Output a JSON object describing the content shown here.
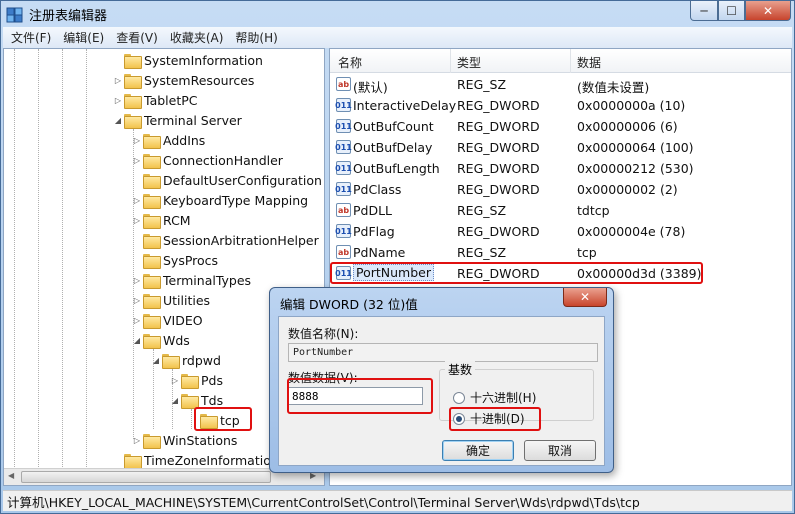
{
  "window": {
    "title": "注册表编辑器",
    "min_label": "─",
    "max_label": "☐",
    "close_label": "✕"
  },
  "menu": [
    "文件(F)",
    "编辑(E)",
    "查看(V)",
    "收藏夹(A)",
    "帮助(H)"
  ],
  "tree": {
    "items": [
      {
        "label": "SystemInformation",
        "arrow": ""
      },
      {
        "label": "SystemResources",
        "arrow": "▷"
      },
      {
        "label": "TabletPC",
        "arrow": "▷"
      },
      {
        "label": "Terminal Server",
        "arrow": "◢"
      },
      {
        "label": "AddIns",
        "arrow": "▷"
      },
      {
        "label": "ConnectionHandler",
        "arrow": "▷"
      },
      {
        "label": "DefaultUserConfiguration",
        "arrow": ""
      },
      {
        "label": "KeyboardType Mapping",
        "arrow": "▷"
      },
      {
        "label": "RCM",
        "arrow": "▷"
      },
      {
        "label": "SessionArbitrationHelper",
        "arrow": ""
      },
      {
        "label": "SysProcs",
        "arrow": ""
      },
      {
        "label": "TerminalTypes",
        "arrow": "▷"
      },
      {
        "label": "Utilities",
        "arrow": "▷"
      },
      {
        "label": "VIDEO",
        "arrow": "▷"
      },
      {
        "label": "Wds",
        "arrow": "◢"
      },
      {
        "label": "rdpwd",
        "arrow": "◢"
      },
      {
        "label": "Pds",
        "arrow": "▷"
      },
      {
        "label": "Tds",
        "arrow": "◢"
      },
      {
        "label": "tcp",
        "arrow": ""
      },
      {
        "label": "WinStations",
        "arrow": "▷"
      },
      {
        "label": "TimeZoneInformation",
        "arrow": ""
      }
    ]
  },
  "list": {
    "headers": [
      "名称",
      "类型",
      "数据"
    ],
    "rows": [
      {
        "icon": "ab",
        "name": "(默认)",
        "type": "REG_SZ",
        "data": "(数值未设置)"
      },
      {
        "icon": "011",
        "name": "InteractiveDelay",
        "type": "REG_DWORD",
        "data": "0x0000000a (10)"
      },
      {
        "icon": "011",
        "name": "OutBufCount",
        "type": "REG_DWORD",
        "data": "0x00000006 (6)"
      },
      {
        "icon": "011",
        "name": "OutBufDelay",
        "type": "REG_DWORD",
        "data": "0x00000064 (100)"
      },
      {
        "icon": "011",
        "name": "OutBufLength",
        "type": "REG_DWORD",
        "data": "0x00000212 (530)"
      },
      {
        "icon": "011",
        "name": "PdClass",
        "type": "REG_DWORD",
        "data": "0x00000002 (2)"
      },
      {
        "icon": "ab",
        "name": "PdDLL",
        "type": "REG_SZ",
        "data": "tdtcp"
      },
      {
        "icon": "011",
        "name": "PdFlag",
        "type": "REG_DWORD",
        "data": "0x0000004e (78)"
      },
      {
        "icon": "ab",
        "name": "PdName",
        "type": "REG_SZ",
        "data": "tcp"
      },
      {
        "icon": "011",
        "name": "PortNumber",
        "type": "REG_DWORD",
        "data": "0x00000d3d (3389)"
      }
    ]
  },
  "status": {
    "path": "计算机\\HKEY_LOCAL_MACHINE\\SYSTEM\\CurrentControlSet\\Control\\Terminal Server\\Wds\\rdpwd\\Tds\\tcp"
  },
  "dialog": {
    "title": "编辑 DWORD (32 位)值",
    "close_label": "✕",
    "name_label": "数值名称(N):",
    "name_value": "PortNumber",
    "value_label": "数值数据(V):",
    "value": "8888",
    "base_label": "基数",
    "hex_label": "十六进制(H)",
    "dec_label": "十进制(D)",
    "base_selected": "decimal",
    "ok_label": "确定",
    "cancel_label": "取消"
  }
}
